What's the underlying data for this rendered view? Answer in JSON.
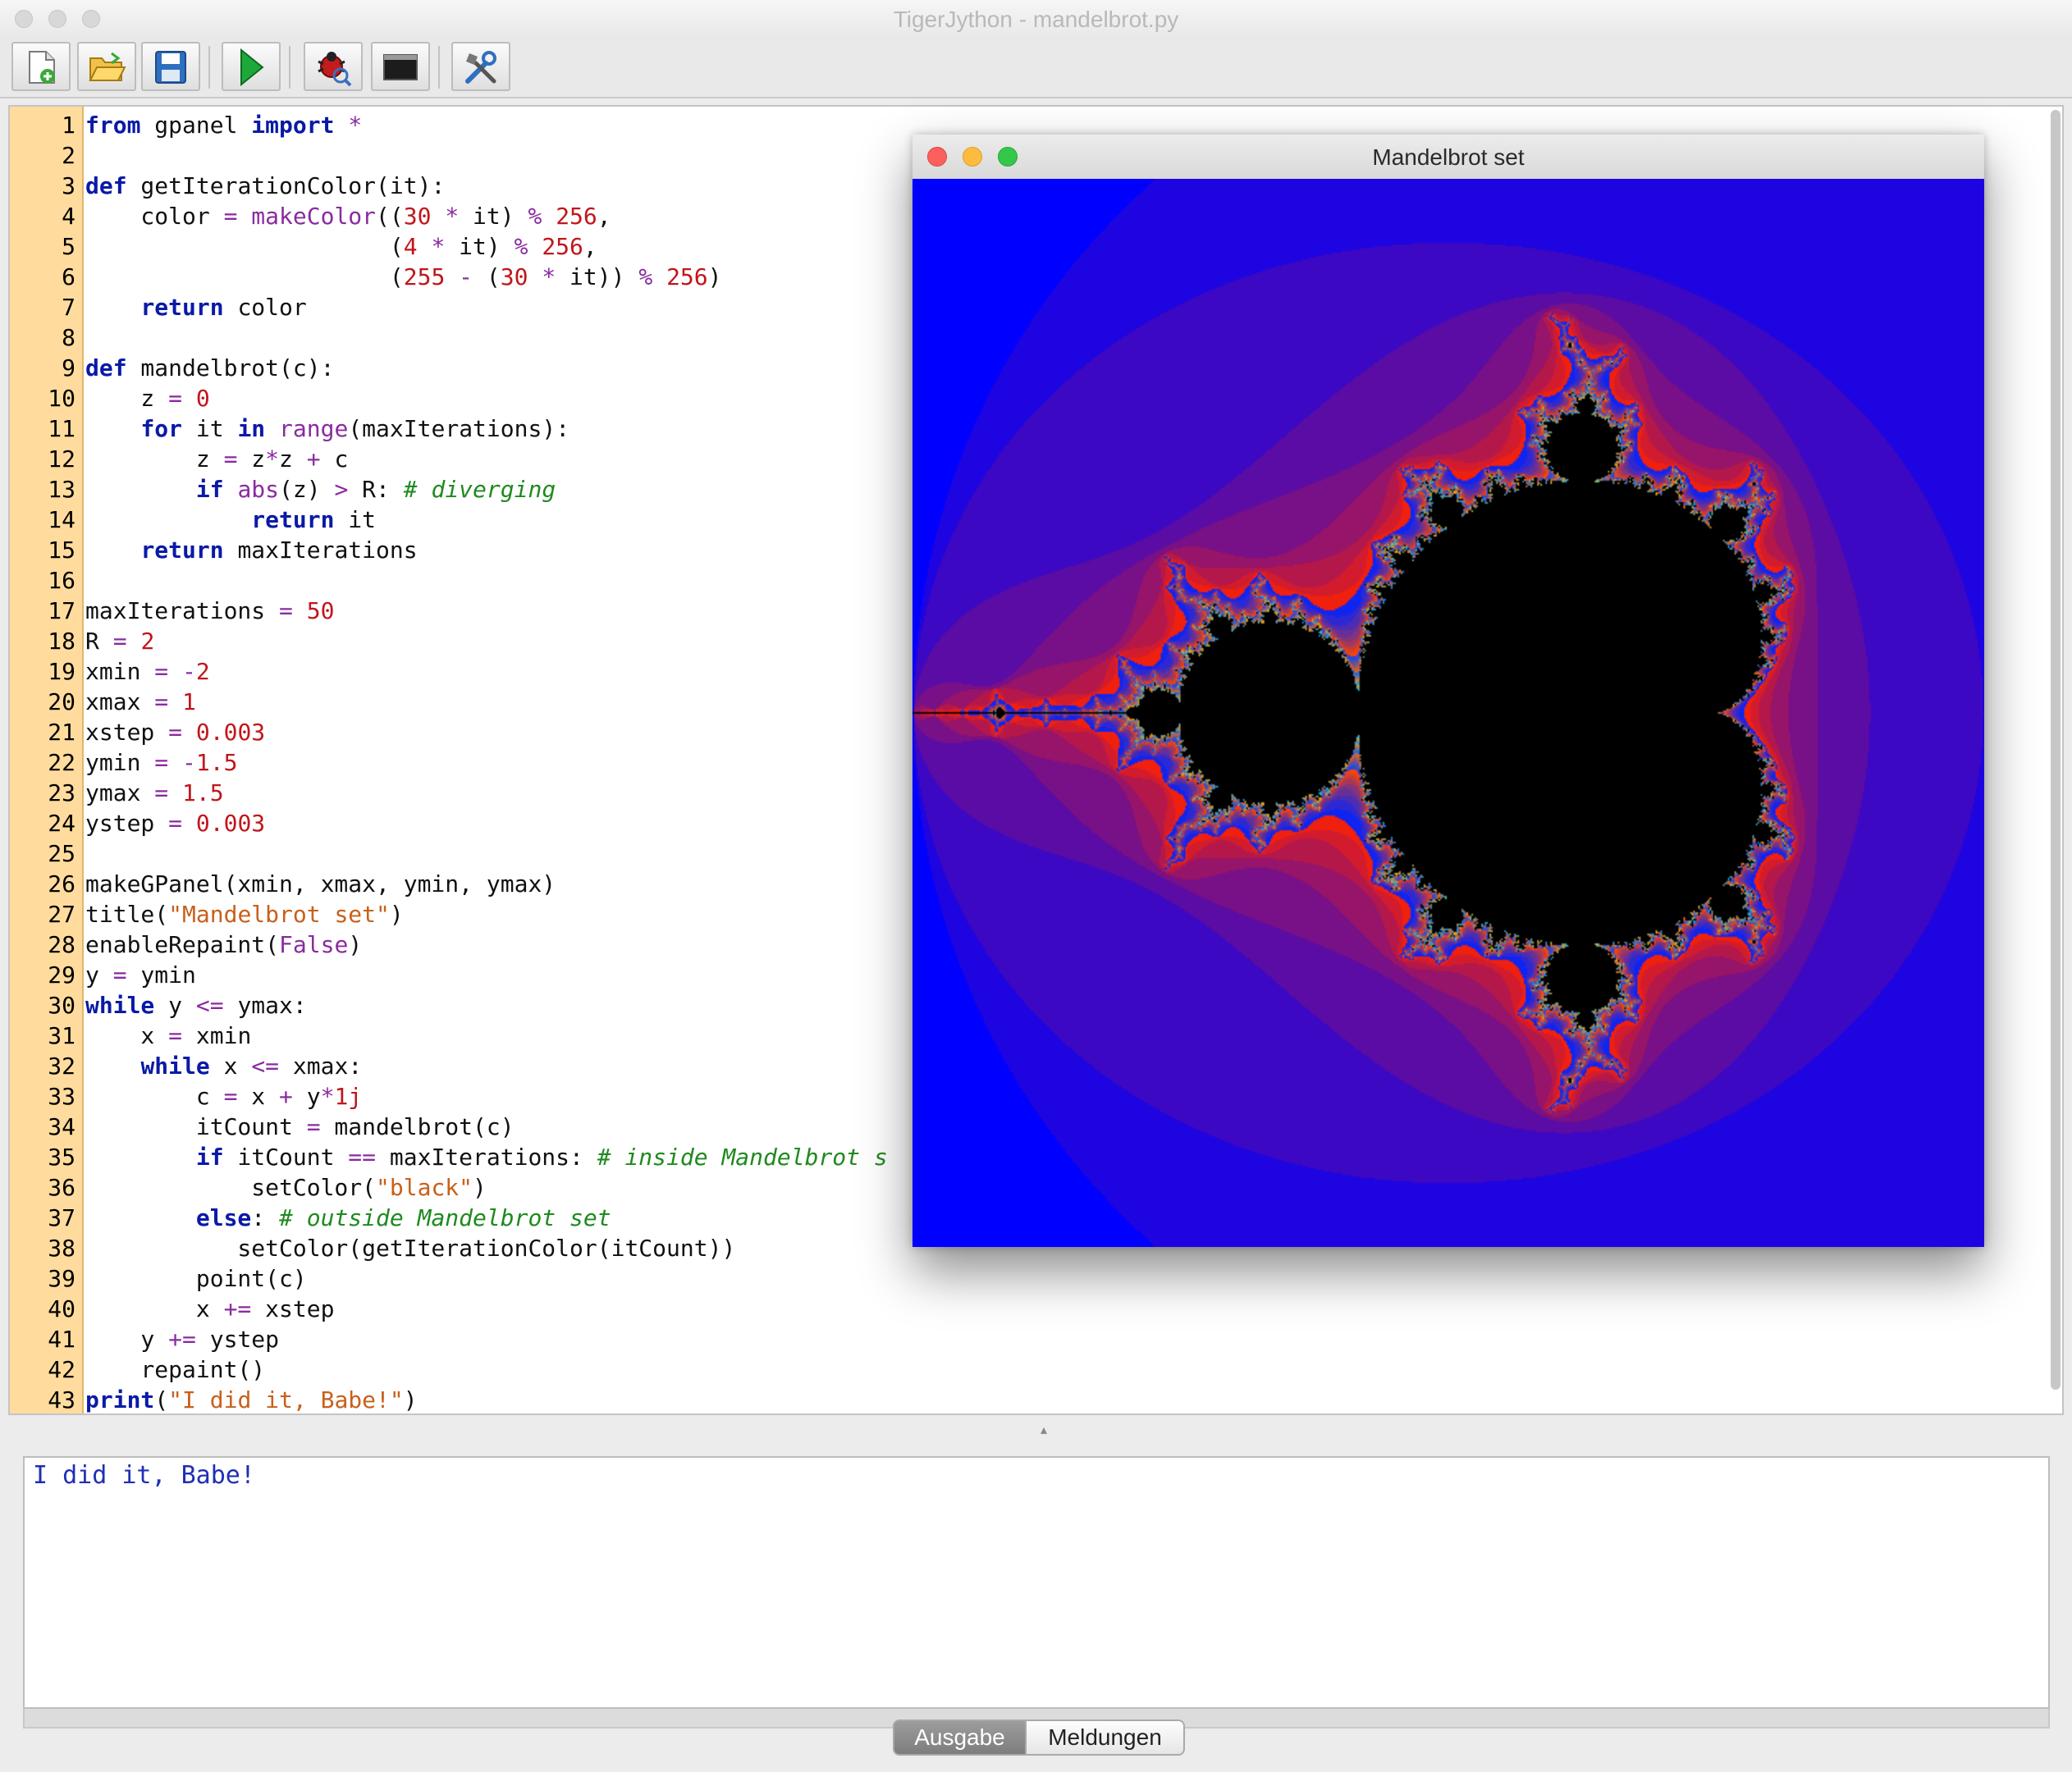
{
  "window": {
    "title": "TigerJython - mandelbrot.py"
  },
  "toolbar": {
    "buttons": [
      {
        "name": "new-file",
        "icon": "new-file-icon"
      },
      {
        "name": "open-file",
        "icon": "folder-open-icon"
      },
      {
        "name": "save-file",
        "icon": "save-icon"
      },
      {
        "name": "run",
        "icon": "play-icon"
      },
      {
        "name": "debug",
        "icon": "bug-icon"
      },
      {
        "name": "console",
        "icon": "terminal-icon"
      },
      {
        "name": "settings",
        "icon": "tools-icon"
      }
    ]
  },
  "editor": {
    "lines": [
      "1",
      "2",
      "3",
      "4",
      "5",
      "6",
      "7",
      "8",
      "9",
      "10",
      "11",
      "12",
      "13",
      "14",
      "15",
      "16",
      "17",
      "18",
      "19",
      "20",
      "21",
      "22",
      "23",
      "24",
      "25",
      "26",
      "27",
      "28",
      "29",
      "30",
      "31",
      "32",
      "33",
      "34",
      "35",
      "36",
      "37",
      "38",
      "39",
      "40",
      "41",
      "42",
      "43"
    ],
    "code": [
      "from gpanel import *",
      "",
      "def getIterationColor(it):",
      "    color = makeColor((30 * it) % 256,",
      "                      (4 * it) % 256,",
      "                      (255 - (30 * it)) % 256)",
      "    return color",
      "",
      "def mandelbrot(c):",
      "    z = 0",
      "    for it in range(maxIterations):",
      "        z = z*z + c",
      "        if abs(z) > R: # diverging",
      "            return it",
      "    return maxIterations",
      "",
      "maxIterations = 50",
      "R = 2",
      "xmin = -2",
      "xmax = 1",
      "xstep = 0.003",
      "ymin = -1.5",
      "ymax = 1.5",
      "ystep = 0.003",
      "",
      "makeGPanel(xmin, xmax, ymin, ymax)",
      "title(\"Mandelbrot set\")",
      "enableRepaint(False)",
      "y = ymin",
      "while y <= ymax:",
      "    x = xmin",
      "    while x <= xmax:",
      "        c = x + y*1j",
      "        itCount = mandelbrot(c)",
      "        if itCount == maxIterations: # inside Mandelbrot s",
      "            setColor(\"black\")",
      "        else: # outside Mandelbrot set",
      "           setColor(getIterationColor(itCount))",
      "        point(c)",
      "        x += xstep",
      "    y += ystep",
      "    repaint()",
      "print(\"I did it, Babe!\")"
    ]
  },
  "mandel_window": {
    "title": "Mandelbrot set"
  },
  "output": {
    "text": "I did it, Babe!"
  },
  "tabs": {
    "ausgabe": "Ausgabe",
    "meldungen": "Meldungen"
  },
  "colors": {
    "gutter": "#ffdc9e",
    "keyword": "#0a1aa6",
    "number": "#c1161b",
    "string": "#c8601a",
    "comment": "#1f8a1f",
    "canvas_background": "#1706e0"
  }
}
